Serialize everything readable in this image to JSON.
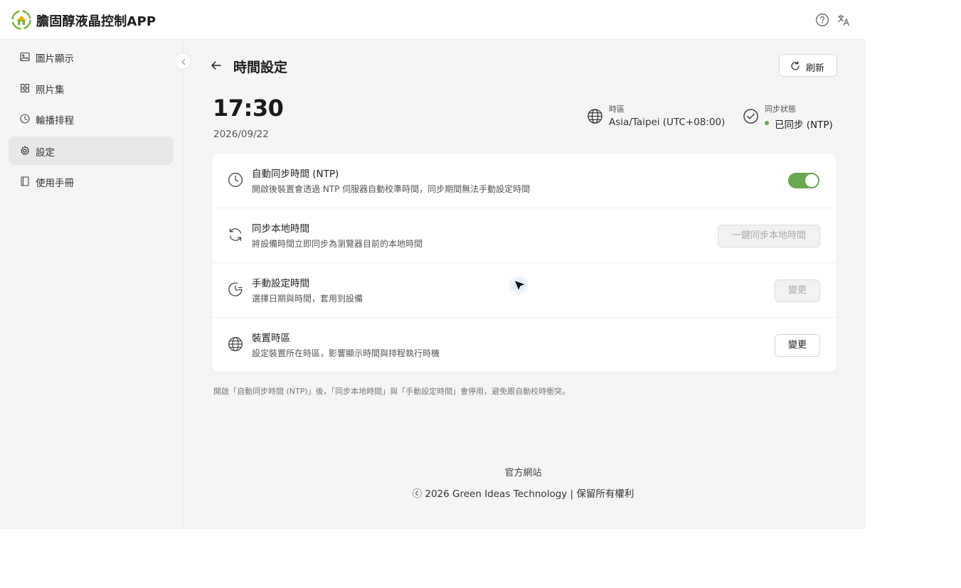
{
  "app": {
    "title": "膽固醇液晶控制APP"
  },
  "sidebar": {
    "items": [
      {
        "label": "圖片顯示",
        "icon": "image-icon"
      },
      {
        "label": "照片集",
        "icon": "grid-icon"
      },
      {
        "label": "輪播排程",
        "icon": "clock-icon"
      },
      {
        "label": "設定",
        "icon": "gear-icon",
        "active": true
      },
      {
        "label": "使用手冊",
        "icon": "book-icon"
      }
    ]
  },
  "page": {
    "title": "時間設定",
    "refresh_label": "刷新"
  },
  "clock": {
    "time": "17:30",
    "date": "2026/09/22"
  },
  "timezone": {
    "label": "時區",
    "value": "Asia/Taipei (UTC+08:00)"
  },
  "sync_status": {
    "label": "同步狀態",
    "value": "已同步 (NTP)"
  },
  "settings": [
    {
      "title": "自動同步時間 (NTP)",
      "description": "開啟後裝置會透過 NTP 伺服器自動校準時間，同步期間無法手動設定時間",
      "icon": "clock-icon"
    },
    {
      "title": "同步本地時間",
      "description": "將設備時間立即同步為瀏覽器目前的本地時間",
      "icon": "sync-icon",
      "button": "一鍵同步本地時間"
    },
    {
      "title": "手動設定時間",
      "description": "選擇日期與時間，套用到設備",
      "icon": "clock-edit-icon",
      "button": "變更"
    },
    {
      "title": "裝置時區",
      "description": "設定裝置所在時區，影響顯示時間與排程執行時機",
      "icon": "globe-icon",
      "button": "變更"
    }
  ],
  "note": "開啟「自動同步時間 (NTP)」後，「同步本地時間」與「手動設定時間」會停用，避免跟自動校時衝突。",
  "footer": {
    "link": "官方網站",
    "copyright": "ⓒ 2026 Green Ideas Technology | 保留所有權利"
  },
  "colors": {
    "accent": "#6aa84f",
    "background": "#f5f5f5",
    "active_nav": "#e8e8e8"
  }
}
